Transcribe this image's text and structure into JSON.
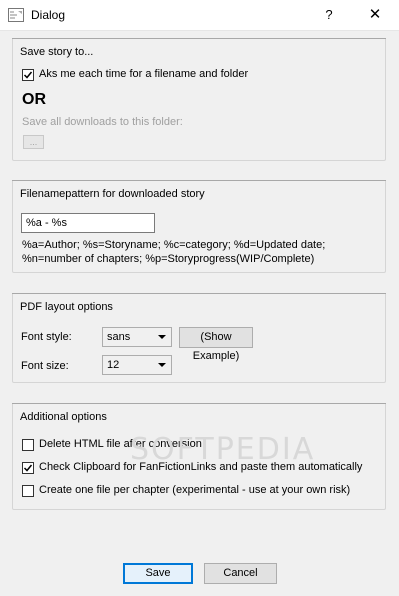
{
  "window": {
    "title": "Dialog",
    "help_glyph": "?",
    "close_glyph": "✕"
  },
  "save_story": {
    "title": "Save story to...",
    "ask_checkbox": {
      "label": "Aks me each time for a filename and folder",
      "checked": true
    },
    "or_label": "OR",
    "folder_label": "Save all downloads to this folder:",
    "browse_label": "..."
  },
  "filename_pattern": {
    "title": "Filenamepattern for downloaded story",
    "value": "%a - %s",
    "help_line1": "%a=Author; %s=Storyname; %c=category; %d=Updated date;",
    "help_line2": "%n=number of chapters; %p=Storyprogress(WIP/Complete)"
  },
  "pdf_layout": {
    "title": "PDF layout options",
    "font_style_label": "Font style:",
    "font_style_value": "sans",
    "show_example_label": "(Show Example)",
    "font_size_label": "Font size:",
    "font_size_value": "12"
  },
  "additional": {
    "title": "Additional options",
    "options": [
      {
        "label": "Delete HTML file after conversion",
        "checked": false
      },
      {
        "label": "Check Clipboard for FanFictionLinks and paste them automatically",
        "checked": true
      },
      {
        "label": "Create one file per chapter (experimental - use at your own risk)",
        "checked": false
      }
    ]
  },
  "buttons": {
    "save": "Save",
    "cancel": "Cancel"
  },
  "watermark": "SOFTPEDIA"
}
